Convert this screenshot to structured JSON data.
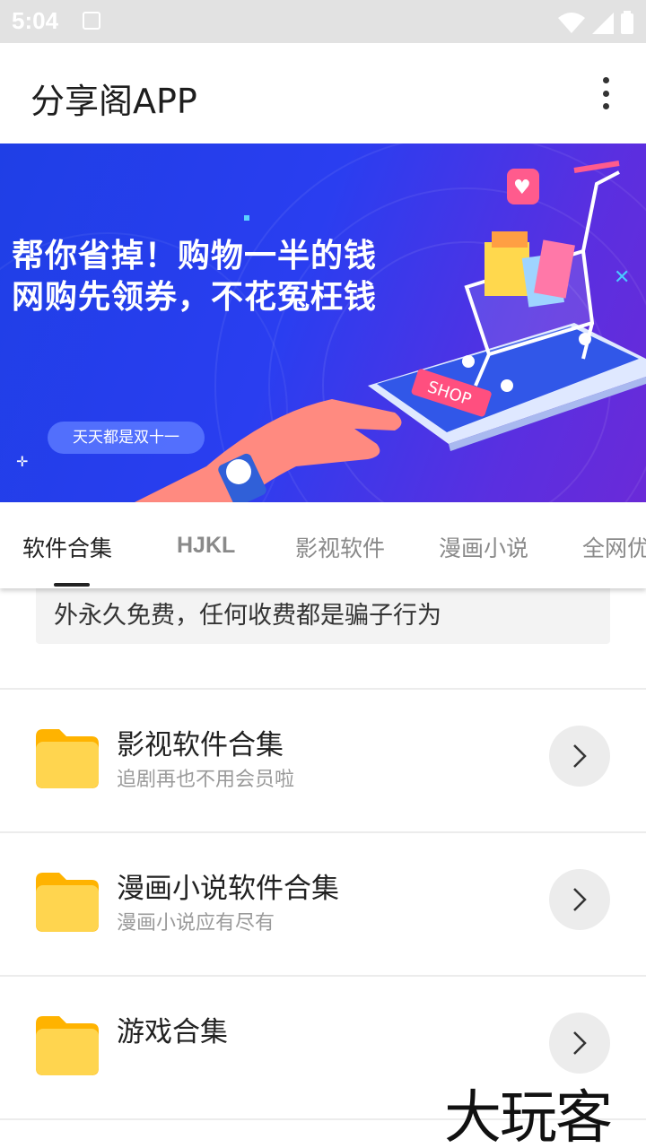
{
  "status_bar": {
    "time": "5:04"
  },
  "app_bar": {
    "title": "分享阁APP",
    "menu_icon": "more-vert-icon"
  },
  "banner": {
    "headline_line1": "帮你省掉！购物一半的钱",
    "headline_line2": "网购先领券，不花冤枉钱",
    "pill": "天天都是双十一",
    "shop_label": "SHOP"
  },
  "tabs": [
    {
      "label": "软件合集",
      "active": true
    },
    {
      "label": "HJKL",
      "active": false
    },
    {
      "label": "影视软件",
      "active": false
    },
    {
      "label": "漫画小说",
      "active": false
    },
    {
      "label": "全网优",
      "active": false
    }
  ],
  "notice": {
    "text": "外永久免费，任何收费都是骗子行为"
  },
  "items": [
    {
      "title": "影视软件合集",
      "subtitle": "追剧再也不用会员啦"
    },
    {
      "title": "漫画小说软件合集",
      "subtitle": "漫画小说应有尽有"
    },
    {
      "title": "游戏合集",
      "subtitle": ""
    }
  ],
  "watermark": "大玩客",
  "colors": {
    "folder": "#FFD54F",
    "folder_tab": "#FFB300",
    "banner_start": "#1f3fe6",
    "banner_end": "#6a2ad8"
  }
}
